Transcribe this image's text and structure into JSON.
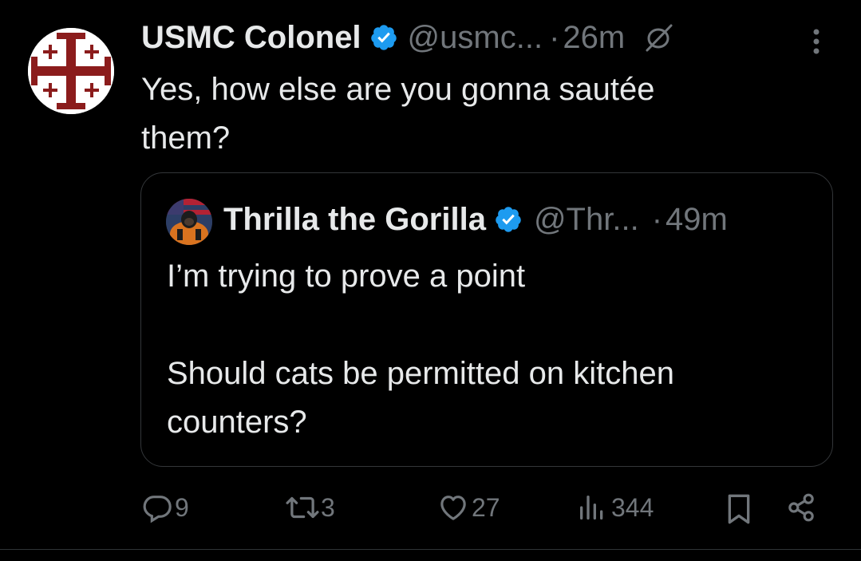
{
  "tweet": {
    "author_name": "USMC Colonel",
    "handle": "@usmc...",
    "separator": "·",
    "time": "26m",
    "text_line1": "Yes, how else are you gonna sautée",
    "text_line2": "them?"
  },
  "quote": {
    "author_name": "Thrilla the Gorilla",
    "handle": "@Thr...",
    "separator": "·",
    "time": "49m",
    "line1": "I’m trying to prove a point",
    "line2": "Should cats be permitted on kitchen",
    "line3": "counters?"
  },
  "actions": {
    "replies": "9",
    "reposts": "3",
    "likes": "27",
    "views": "344"
  },
  "colors": {
    "verified": "#1d9bf0",
    "muted_text": "#71767b",
    "text": "#e7e9ea",
    "background": "#000000",
    "cross": "#8b1c1c"
  },
  "icons": [
    "jerusalem-cross-avatar",
    "verified-badge-icon",
    "mute-icon",
    "more-icon",
    "reply-icon",
    "repost-icon",
    "like-icon",
    "views-icon",
    "bookmark-icon",
    "share-icon"
  ]
}
